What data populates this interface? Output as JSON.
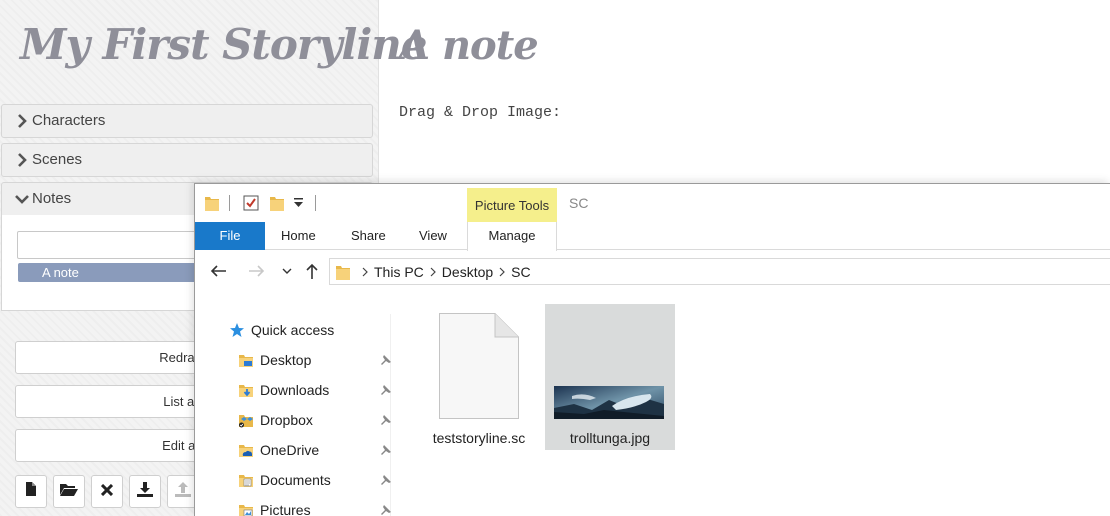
{
  "sidebar": {
    "app_title": "My First Storyline",
    "sections": [
      {
        "label": "Characters"
      },
      {
        "label": "Scenes"
      },
      {
        "label": "Notes"
      }
    ],
    "notes": {
      "input_value": "",
      "items": [
        {
          "label": "A note"
        }
      ]
    },
    "buttons": [
      {
        "label": "Redraw the"
      },
      {
        "label": "List all the"
      },
      {
        "label": "Edit all the"
      }
    ],
    "toolbar_icons": [
      "new-file-icon",
      "open-folder-icon",
      "delete-icon",
      "download-icon",
      "upload-icon"
    ]
  },
  "main": {
    "note_title": "A note",
    "drop_label": "Drag & Drop Image:"
  },
  "explorer": {
    "picture_tools": "Picture Tools",
    "window_title": "SC",
    "tabs": [
      {
        "label": "File"
      },
      {
        "label": "Home"
      },
      {
        "label": "Share"
      },
      {
        "label": "View"
      },
      {
        "label": "Manage"
      }
    ],
    "breadcrumb": [
      {
        "label": "This PC"
      },
      {
        "label": "Desktop"
      },
      {
        "label": "SC"
      }
    ],
    "nav_items": [
      {
        "label": "Quick access"
      },
      {
        "label": "Desktop"
      },
      {
        "label": "Downloads"
      },
      {
        "label": "Dropbox"
      },
      {
        "label": "OneDrive"
      },
      {
        "label": "Documents"
      },
      {
        "label": "Pictures"
      }
    ],
    "files": [
      {
        "name": "teststoryline.sc"
      },
      {
        "name": "trolltunga.jpg"
      }
    ]
  },
  "colors": {
    "title_gray": "#8f8f99",
    "note_selected": "#8a9bbb",
    "file_tab_blue": "#1979ca",
    "picture_tools_yellow": "#f5ef8c",
    "selected_tile": "#d9dbdb"
  }
}
